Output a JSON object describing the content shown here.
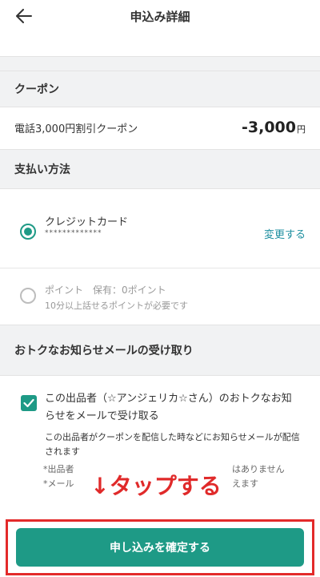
{
  "header": {
    "title": "申込み詳細"
  },
  "coupon": {
    "section_title": "クーポン",
    "name": "電話3,000円割引クーポン",
    "amount": "-3,000",
    "unit": "円"
  },
  "payment": {
    "section_title": "支払い方法",
    "options": [
      {
        "label": "クレジットカード",
        "detail": "*************",
        "action": "変更する",
        "selected": true
      },
      {
        "label": "ポイント　保有：0ポイント",
        "detail": "10分以上話せるポイントが必要です",
        "selected": false
      }
    ]
  },
  "mail": {
    "section_title": "おトクなお知らせメールの受け取り",
    "checkbox_label": "この出品者（☆アンジェリカ☆さん）のおトクなお知らせをメールで受け取る",
    "description": "この出品者がクーポンを配信した時などにお知らせメールが配信されます",
    "note1_left": "*出品者",
    "note1_right": "はありません",
    "note2_left": "*メール",
    "note2_right": "えます",
    "checked": true
  },
  "overlay": {
    "tap_text": "↓タップする"
  },
  "cta": {
    "label": "申し込みを確定する"
  },
  "colors": {
    "accent": "#1e9a86",
    "highlight": "#e32a2a",
    "link": "#1e8fa0"
  }
}
